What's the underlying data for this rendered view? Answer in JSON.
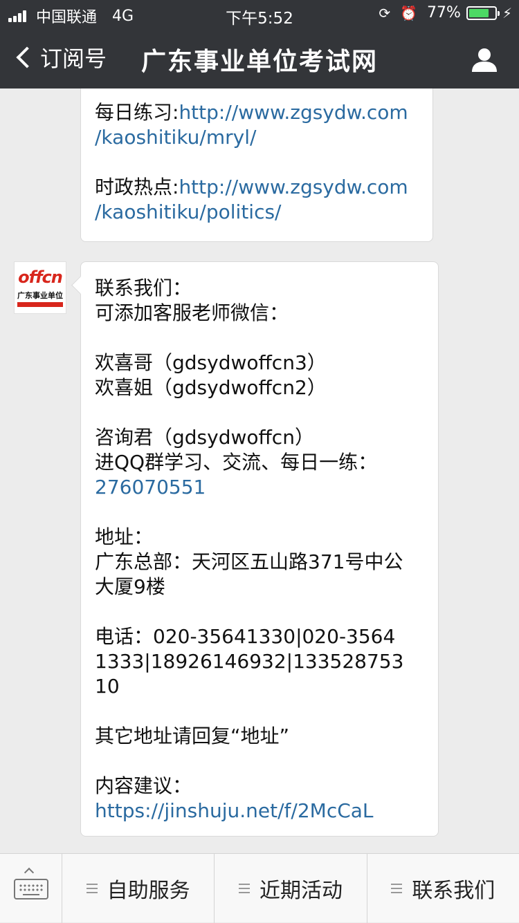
{
  "status_bar": {
    "carrier": "中国联通",
    "network": "4G",
    "time": "下午5:52",
    "battery": "77%",
    "battery_level": 0.77
  },
  "nav": {
    "back_label": "订阅号",
    "title": "广东事业单位考试网"
  },
  "messages": {
    "first": {
      "lines": [
        {
          "label": "每日练习:",
          "link": "http://www.zgsydw.com",
          "link2": "/kaoshitiku/mryl/"
        },
        {
          "label": "时政热点:",
          "link": "http://www.zgsydw.com",
          "link2": "/kaoshitiku/politics/"
        }
      ]
    },
    "second": {
      "avatar_logo": "offcn",
      "avatar_sub": "广东事业单位",
      "contact_title": "联系我们：",
      "wechat_intro": "可添加客服老师微信：",
      "wechat_1": "欢喜哥（gdsydwoffcn3）",
      "wechat_2": "欢喜姐（gdsydwoffcn2）",
      "wechat_3": "咨询君（gdsydwoffcn）",
      "qq_intro": "进QQ群学习、交流、每日一练：",
      "qq_number": "276070551",
      "address_title": "地址：",
      "address_line1": "广东总部：天河区五山路371号中公",
      "address_line2": "大厦9楼",
      "phone_line1": "电话：020-35641330|020-3564",
      "phone_line2": "1333|18926146932|133528753",
      "phone_line3": "10",
      "other_address": "其它地址请回复“地址”",
      "suggest_title": "内容建议：",
      "suggest_link": "https://jinshuju.net/f/2McCaL"
    }
  },
  "menu": {
    "items": [
      "自助服务",
      "近期活动",
      "联系我们"
    ]
  },
  "colors": {
    "bar_bg": "#333539",
    "chat_bg": "#ececec",
    "link": "#2a6aa0",
    "battery_fill": "#4cd964"
  }
}
